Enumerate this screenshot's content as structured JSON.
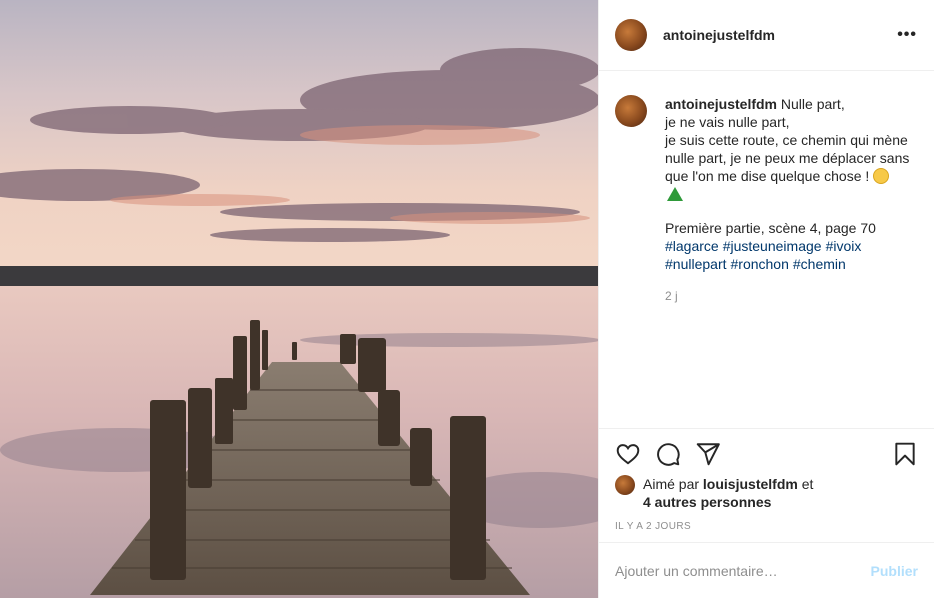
{
  "post": {
    "username": "antoinejustelfdm",
    "more_label": "•••",
    "image_alt_icon": "lake-pier-photo"
  },
  "caption": {
    "username": "antoinejustelfdm",
    "lines": [
      "Nulle part,",
      "je ne vais nulle part,",
      "je suis cette route, ce chemin qui mène",
      "nulle part, je ne peux me déplacer sans",
      "que l'on me dise quelque chose !"
    ],
    "emoji_icon": "unamused-face-emoji",
    "triangle_icon": "green-triangle-emoji",
    "part_line": "Première partie, scène 4, page 70",
    "hashtags_row1": [
      "#lagarce",
      "#justeuneimage",
      "#ivoix"
    ],
    "hashtags_row2": [
      "#nullepart",
      "#ronchon",
      "#chemin"
    ],
    "time": "2 j"
  },
  "actions": {
    "like_icon": "heart-icon",
    "comment_icon": "comment-icon",
    "share_icon": "paper-plane-icon",
    "save_icon": "bookmark-icon"
  },
  "likes": {
    "prefix": "Aimé par",
    "user": "louisjustelfdm",
    "conj": "et",
    "others": "4 autres personnes"
  },
  "ago": "IL Y A 2 JOURS",
  "comment": {
    "placeholder": "Ajouter un commentaire…",
    "publish_label": "Publier"
  },
  "colors": {
    "link": "#00376b",
    "muted": "#8e8e8e",
    "publish_disabled": "#b2dffc"
  }
}
